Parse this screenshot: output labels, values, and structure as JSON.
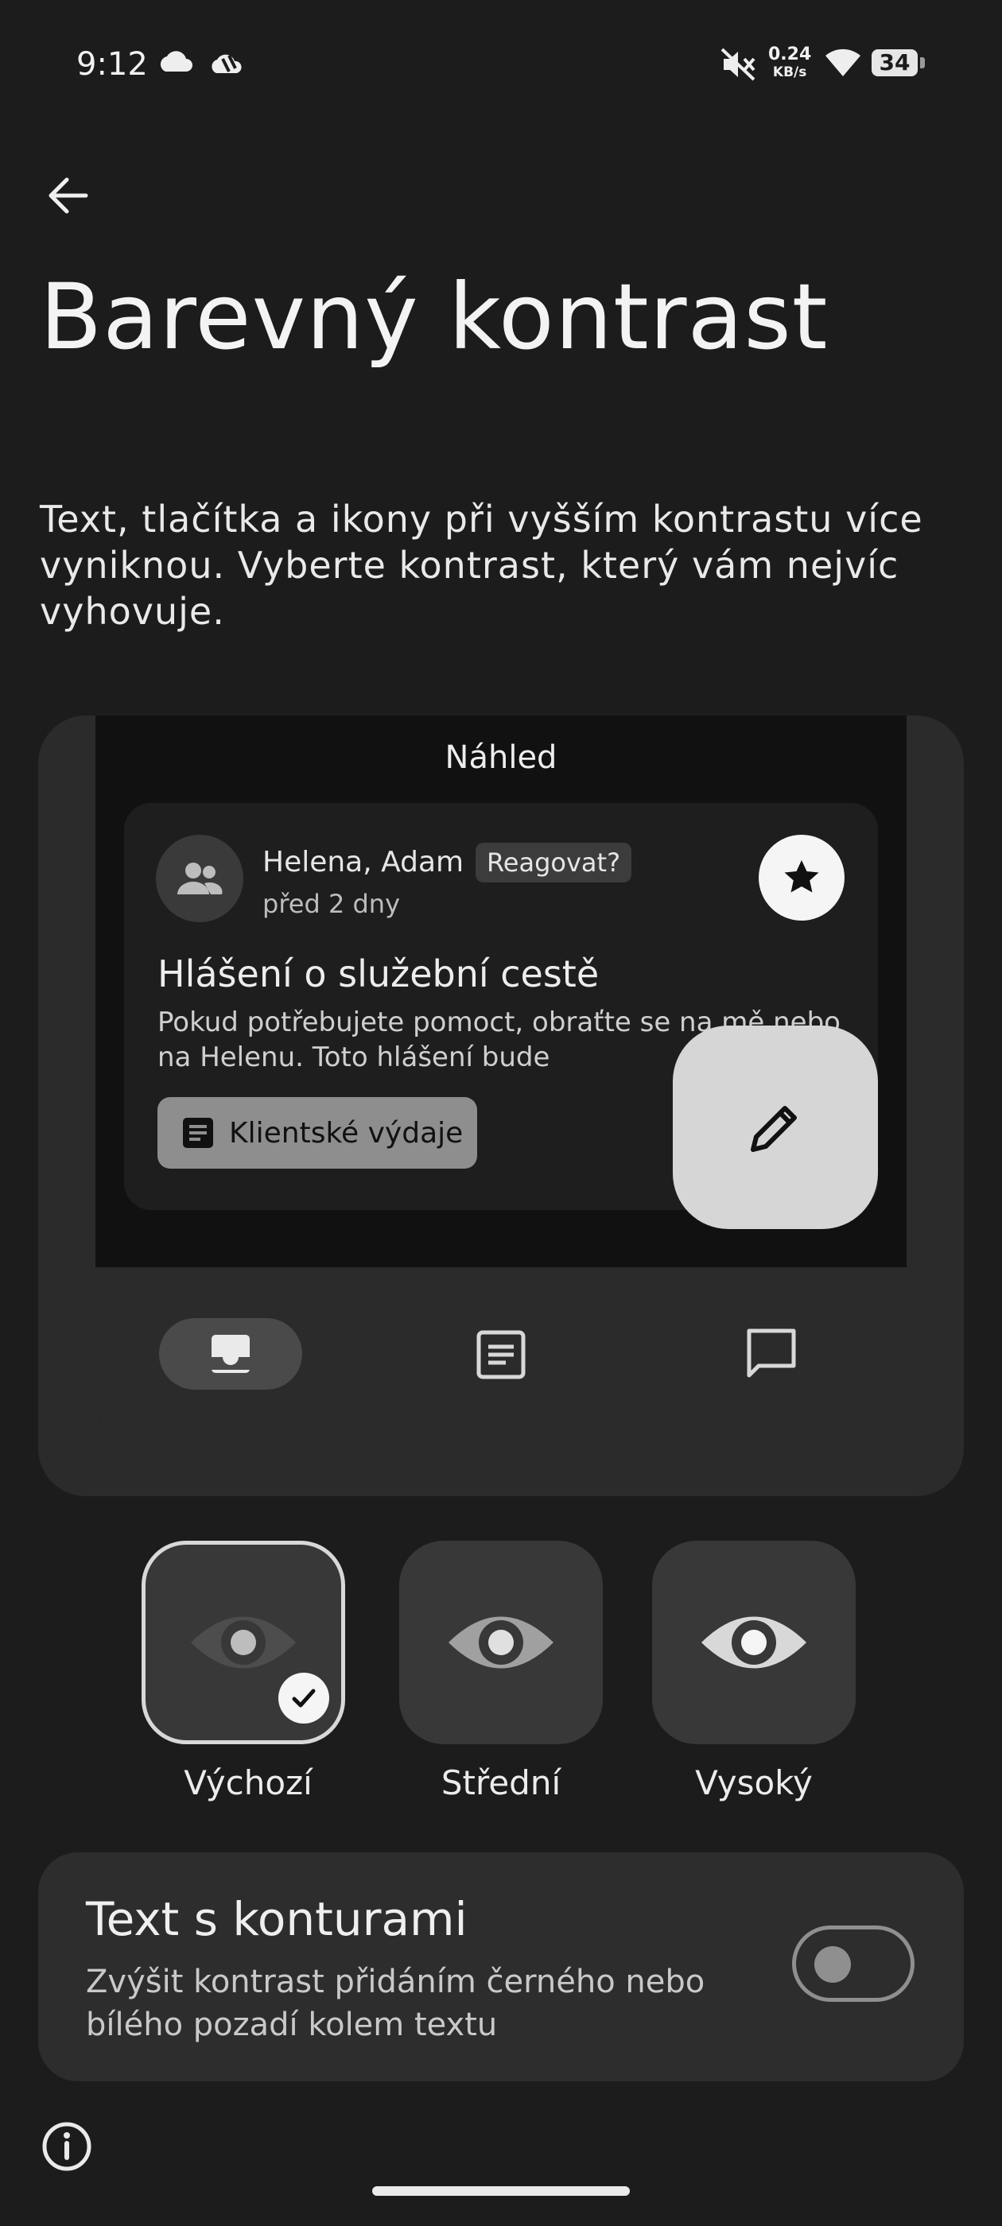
{
  "status_bar": {
    "time": "9:12",
    "net_speed_value": "0.24",
    "net_speed_unit": "KB/s",
    "battery": "34"
  },
  "page": {
    "title": "Barevný kontrast",
    "description": "Text, tlačítka a ikony při vyšším kontrastu více vyniknou. Vyberte kontrast, který vám nejvíc vyhovuje."
  },
  "preview": {
    "label": "Náhled",
    "sender": "Helena, Adam",
    "chip": "Reagovat?",
    "time_ago": "před 2 dny",
    "subject": "Hlášení o služební cestě",
    "snippet": "Pokud potřebujete pomoct, obraťte se na mě nebo na Helenu. Toto hlášení bude",
    "attachment": "Klientské výdaje"
  },
  "contrast_options": [
    {
      "label": "Výchozí",
      "selected": true
    },
    {
      "label": "Střední",
      "selected": false
    },
    {
      "label": "Vysoký",
      "selected": false
    }
  ],
  "outline_text": {
    "title": "Text s konturami",
    "subtitle": "Zvýšit kontrast přidáním černého nebo bílého pozadí kolem textu",
    "enabled": false
  },
  "icons": {
    "back": "arrow-left-icon",
    "info": "info-icon",
    "status": [
      "cloud-icon",
      "weather-icon",
      "mute-icon",
      "wifi-icon",
      "battery-icon"
    ]
  }
}
